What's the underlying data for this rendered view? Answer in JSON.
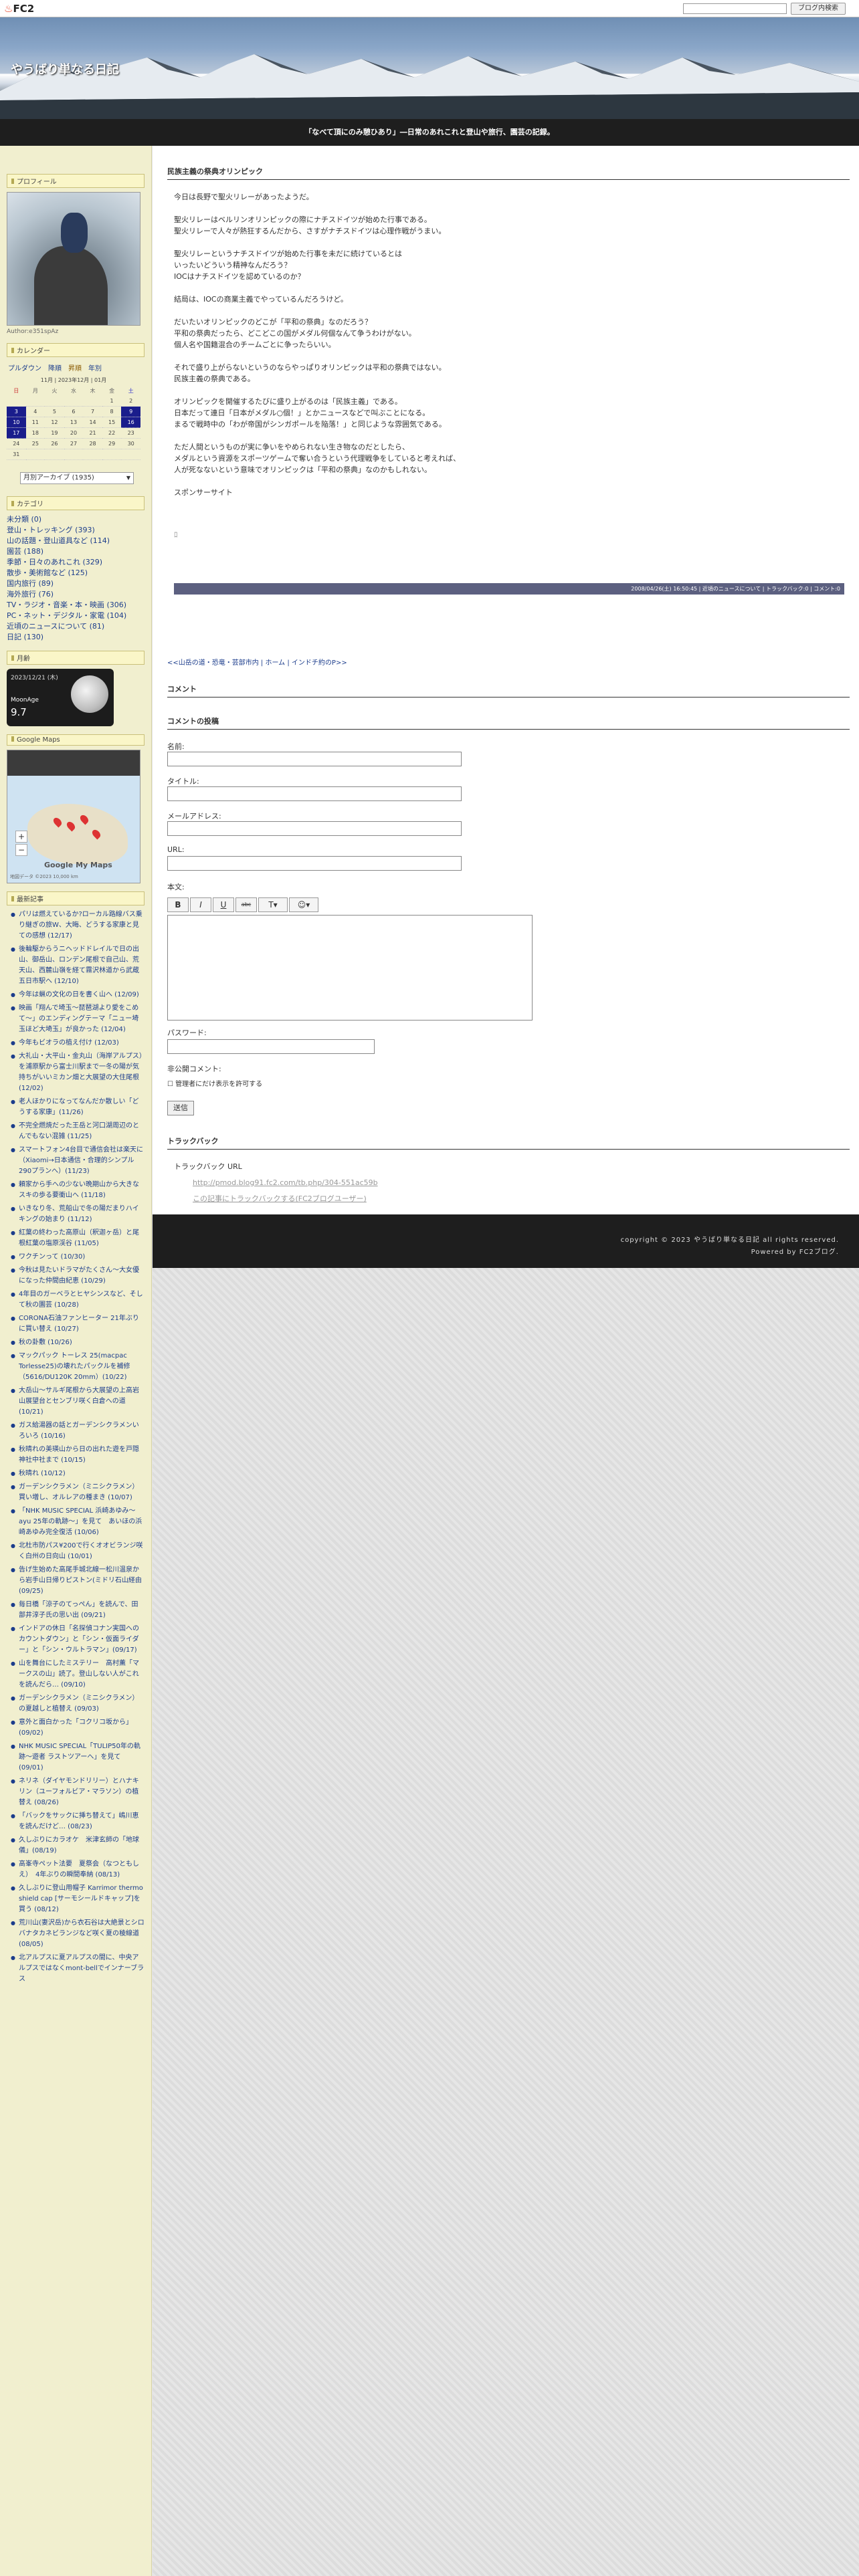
{
  "fc2bar": {
    "logo": "FC2",
    "search_button": "ブログ内検索"
  },
  "header": {
    "title": "やうばり単なる日記",
    "tagline": "「なべて頂にのみ憩ひあり」―日常のあれこれと登山や旅行、園芸の記録。"
  },
  "sidebar": {
    "profile": {
      "title": "プロフィール",
      "author": "Author:e351spAz"
    },
    "calendar": {
      "title": "カレンダー",
      "tabs": [
        "プルダウン",
        "降順",
        "昇順",
        "年別"
      ],
      "caption": "11月 | 2023年12月 | 01月",
      "weekdays": [
        "日",
        "月",
        "火",
        "水",
        "木",
        "金",
        "土"
      ],
      "rows": [
        [
          "",
          "",
          "",
          "",
          "",
          "1",
          "2"
        ],
        [
          "3",
          "4",
          "5",
          "6",
          "7",
          "8",
          "9"
        ],
        [
          "10",
          "11",
          "12",
          "13",
          "14",
          "15",
          "16"
        ],
        [
          "17",
          "18",
          "19",
          "20",
          "21",
          "22",
          "23"
        ],
        [
          "24",
          "25",
          "26",
          "27",
          "28",
          "29",
          "30"
        ],
        [
          "31",
          "",
          "",
          "",
          "",
          "",
          ""
        ]
      ]
    },
    "archive_select": "月別アーカイブ (1935)",
    "categories": {
      "title": "カテゴリ",
      "items": [
        "未分類 (0)",
        "登山・トレッキング (393)",
        "山の話題・登山道具など (114)",
        "園芸 (188)",
        "季節・日々のあれこれ (329)",
        "散歩・美術館など (125)",
        "国内旅行 (89)",
        "海外旅行 (76)",
        "TV・ラジオ・音楽・本・映画 (306)",
        "PC・ネット・デジタル・家電 (104)",
        "近頃のニュースについて (81)",
        "日記 (130)"
      ]
    },
    "moon": {
      "title": "月齢",
      "date": "2023/12/21 (木)",
      "label": "MoonAge",
      "age": "9.7"
    },
    "map": {
      "title": "Google Maps",
      "logo": "Google My Maps",
      "copy": "地図データ ©2023   10,000 km"
    },
    "recent": {
      "title": "最新記事",
      "items": [
        "パリは燃えているか?ローカル路線バス乗り継ぎの旅W、大晦、どうする家康と見ての感想 (12/17)",
        "後輪駆からうニヘッドドレイルで日の出山、御岳山、ロンデン尾根で自己山、荒天山、西麓山嶺を経て霧沢林道から武蔵五日市駅へ (12/10)",
        "今年は蝋の文化の日を書く山へ (12/09)",
        "映画「翔んで埼玉〜琵琶湖より愛をこめて〜」のエンディングテーマ「ニュー埼玉ほど大埼玉」が良かった (12/04)",
        "今年もビオラの植え付け (12/03)",
        "大礼山・大平山・金丸山（海岸アルプス）を浦原駅から富士川駅まで一冬の陽が気持ちがいいミカン畑と大展望の大住尾根 (12/02)",
        "老人ほかりになってなんだか散しい「どうする家康」(11/26)",
        "不完全燃焼だった王岳と河口湖周辺のとんでもない混雑 (11/25)",
        "スマートフォン4台目で通信会社は楽天に（Xiaomi→日本通信・合理的シンプル290プランへ）(11/23)",
        "頼家から手への少ない晩期山から大きなスキの歩る要衝山へ (11/18)",
        "いきなり冬、荒船山で冬の陽だまりハイキングの始まり (11/12)",
        "紅葉の終わった高原山（釈迦ヶ岳）と尾根紅葉の塩原渓谷 (11/05)",
        "ワクチンって (10/30)",
        "今秋は見たいドラマがたくさん〜大女優になった仲間由紀恵 (10/29)",
        "4年目のガーベラとヒヤシンスなど、そして秋の園芸 (10/28)",
        "CORONA石油ファンヒーター 21年ぶりに買い替え (10/27)",
        "秋の卦敷 (10/26)",
        "マックパック トーレス 25(macpac Torlesse25)の壊れたパックルを補修（5616/DU120K 20mm）(10/22)",
        "大岳山〜サルギ尾根から大展望の上高岩山展望台とセンブリ咲く白倉への道 (10/21)",
        "ガス給湯器の話とガーデンシクラメンいろいろ (10/16)",
        "秋晴れの美瑛山から日の出れた遊を戸隠神社中社まで (10/15)",
        "秋晴れ (10/12)",
        "ガーデンシクラメン（ミニシクラメン）買い増し、オルレアの種まき (10/07)",
        "「NHK MUSIC SPECIAL 浜崎あゆみ〜ayu 25年の軌跡〜」を見て　あいほの浜崎あゆみ完全復活 (10/06)",
        "北杜市防パス¥200で行くオオビランジ咲く白州の日向山 (10/01)",
        "告げ生始めた高尾手城北線一松川温泉から岩手山日帰りピストン(ミドリ石山経由 (09/25)",
        "毎日橋「涼子のてっぺん」を読んで、田部井淳子氏の思い出 (09/21)",
        "インドアの休日「名探偵コナン実国へのカウントダウン」と「シン・仮面ライダー」と「シン・ウルトラマン」(09/17)",
        "山を舞台にしたミステリー　高村薫「マークスの山」読了。登山しない人がこれを読んだら… (09/10)",
        "ガーデンシクラメン（ミニシクラメン）の夏越しと植替え (09/03)",
        "意外と面白かった「コクリコ坂から」(09/02)",
        "NHK MUSIC SPECIAL「TULIP50年の軌跡〜遊者 ラストツアーへ」を見て (09/01)",
        "ネリネ（ダイヤモンドリリー）とハナキリン（ユーフォルビア・マラソン）の植替え (08/26)",
        "「バックをサックに挿ち替えて」嶋川恵　を読んだけど… (08/23)",
        "久しぶりにカラオケ　米津玄師の「地球儀」(08/19)",
        "高峯寺ペット法要　夏祭会（なつともしえ）　4年ぶりの瞬間奉納 (08/13)",
        "久しぶりに登山用帽子 Karrimor thermo shield cap [サーモシールドキャップ]を買う (08/12)",
        "荒川山(妻沢岳)から衣石谷は大絶景とシロバナタカネビランジなど咲く夏の稜線道 (08/05)",
        "北アルプスに夏アルプスの間に、中央アルプスではなくmont-bellでインナーブラス"
      ]
    }
  },
  "entry": {
    "title": "民族主義の祭典オリンピック",
    "paragraphs": [
      "今日は長野で聖火リレーがあったようだ。",
      "聖火リレーはベルリンオリンピックの際にナチスドイツが始めた行事である。\n聖火リレーで人々が熱狂するんだから、さすがナチスドイツは心理作戦がうまい。",
      "聖火リレーというナチスドイツが始めた行事を未だに続けているとは\nいったいどういう精神なんだろう？\nIOCはナチスドイツを認めているのか？",
      "結局は、IOCの商業主義でやっているんだろうけど。",
      "だいたいオリンピックのどこが「平和の祭典」なのだろう？\n平和の祭典だったら、どこどこの国がメダル何個なんて争うわけがない。\n個人名や国籍混合のチームごとに争ったらいい。",
      "それで盛り上がらないというのならやっぱりオリンピックは平和の祭典ではない。\n民族主義の祭典である。",
      "オリンピックを開催するたびに盛り上がるのは「民族主義」である。\n日本だって連日「日本がメダル○個！」とかニュースなどで叫ぶことになる。\nまるで戦時中の「わが帝国がシンガポールを陥落！」と同じような雰囲気である。",
      "ただ人間というものが実に争いをやめられない生き物なのだとしたら、\nメダルという資源をスポーツゲームで奪い合うという代理戦争をしていると考えれば、\n人が死なないという意味でオリンピックは「平和の祭典」なのかもしれない。",
      "スポンサーサイト",
      "ﾛ"
    ],
    "footbar": "2008/04/26(土) 16:50:45 | 近頃のニュースについて | トラックバック:0 | コメント:0",
    "prevnext": "<<山岳の道・恐竜・芸部市内 | ホーム | インドチ約のP>>"
  },
  "comment": {
    "section_title": "コメント",
    "form_title": "コメントの投稿",
    "name_label": "名前:",
    "title_label": "タイトル:",
    "mail_label": "メールアドレス:",
    "url_label": "URL:",
    "body_label": "本文:",
    "toolbar": [
      "B",
      "I",
      "U",
      "abc",
      "T▾",
      "☺▾"
    ],
    "password_label": "パスワード:",
    "secret_label": "非公開コメント:",
    "secret_check": "管理者にだけ表示を許可する",
    "send": "送信"
  },
  "trackback": {
    "title": "トラックバック",
    "url_label": "トラックバック URL",
    "url": "http://pmod.blog91.fc2.com/tb.php/304-551ac59b",
    "link": "この記事にトラックバックする(FC2ブログユーザー)"
  },
  "footer": {
    "copyright": "copyright © 2023 やうばり単なる日記 all rights reserved.",
    "powered": "Powered by FC2ブログ."
  }
}
